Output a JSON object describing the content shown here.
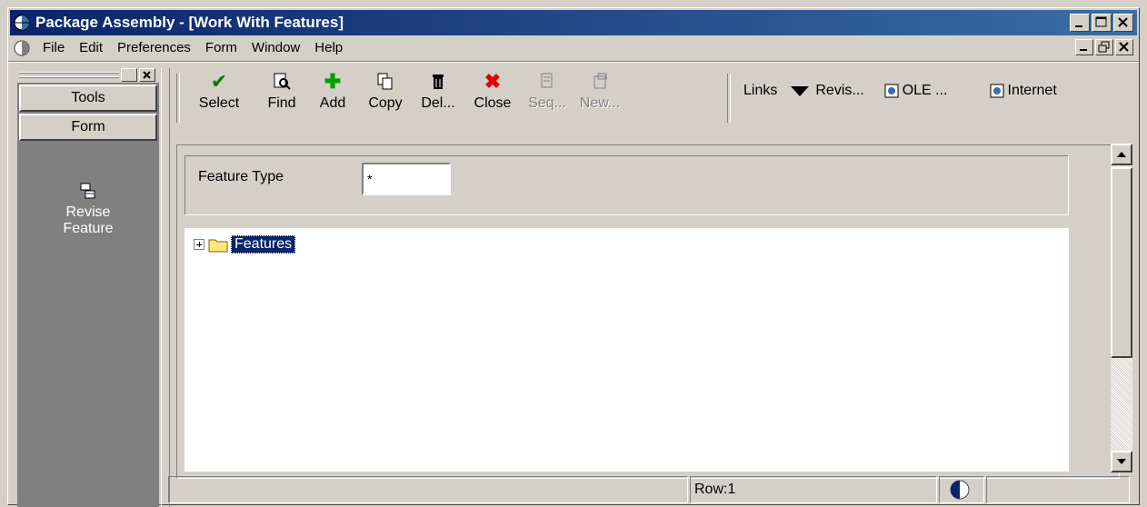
{
  "window": {
    "title": "Package Assembly - [Work With Features]"
  },
  "menu": {
    "items": [
      "File",
      "Edit",
      "Preferences",
      "Form",
      "Window",
      "Help"
    ]
  },
  "exit_bar": {
    "tools_label": "Tools",
    "form_label": "Form",
    "item_label_line1": "Revise",
    "item_label_line2": "Feature"
  },
  "toolbar": {
    "select": "Select",
    "find": "Find",
    "add": "Add",
    "copy": "Copy",
    "delete": "Del...",
    "close": "Close",
    "sequence": "Seq...",
    "new": "New...",
    "links": "Links",
    "revis": "Revis...",
    "ole": "OLE ...",
    "internet": "Internet"
  },
  "query": {
    "feature_type_label": "Feature Type",
    "feature_type_value": "*"
  },
  "tree": {
    "root_label": "Features"
  },
  "status": {
    "row": "Row:1"
  },
  "colors": {
    "title_bar": "#0a246a",
    "face": "#d4d0c8",
    "exit_bar": "#808080",
    "select_green": "#008000",
    "close_red": "#e00000"
  }
}
